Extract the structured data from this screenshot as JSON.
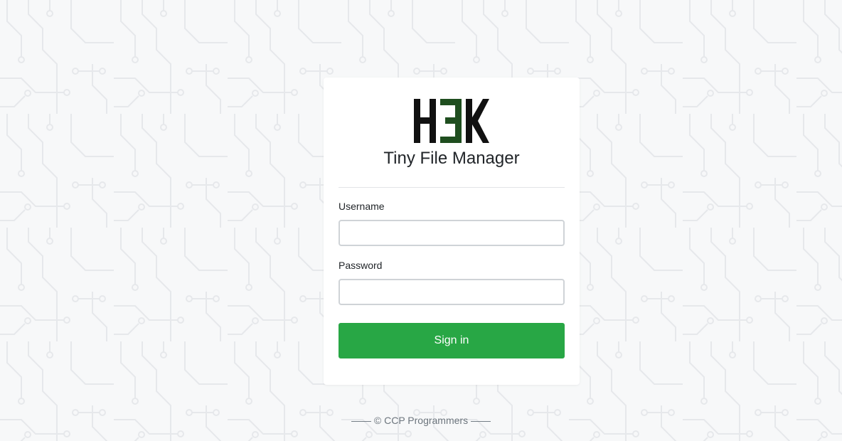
{
  "app": {
    "logo_text": "H3K",
    "title": "Tiny File Manager"
  },
  "form": {
    "username_label": "Username",
    "username_value": "",
    "password_label": "Password",
    "password_value": "",
    "signin_label": "Sign in"
  },
  "footer": {
    "text": "—— © CCP Programmers ——"
  },
  "colors": {
    "background": "#f7f8f9",
    "pattern": "#e8eaed",
    "logo_dark": "#111111",
    "logo_accent": "#1f4e1f",
    "button": "#28a745"
  }
}
